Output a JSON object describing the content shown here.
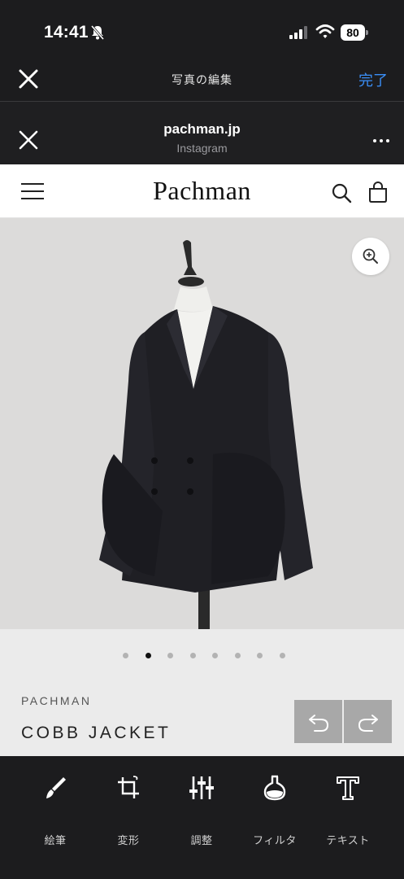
{
  "status_bar": {
    "time": "14:41",
    "battery": "80"
  },
  "edit_header": {
    "title": "写真の編集",
    "done_label": "完了"
  },
  "browser": {
    "domain": "pachman.jp",
    "source": "Instagram"
  },
  "site": {
    "brand": "Pachman"
  },
  "carousel": {
    "count": 8,
    "active_index": 1
  },
  "product": {
    "brand": "PACHMAN",
    "name": "COBB JACKET"
  },
  "toolbar": {
    "tools": [
      {
        "label": "絵筆",
        "icon": "brush-icon"
      },
      {
        "label": "変形",
        "icon": "crop-rotate-icon"
      },
      {
        "label": "調整",
        "icon": "sliders-icon"
      },
      {
        "label": "フィルタ",
        "icon": "filter-flask-icon"
      },
      {
        "label": "テキスト",
        "icon": "text-icon"
      }
    ]
  },
  "colors": {
    "accent": "#3a8ef6",
    "background": "#1c1c1e",
    "image_bg": "#dcdbda"
  }
}
